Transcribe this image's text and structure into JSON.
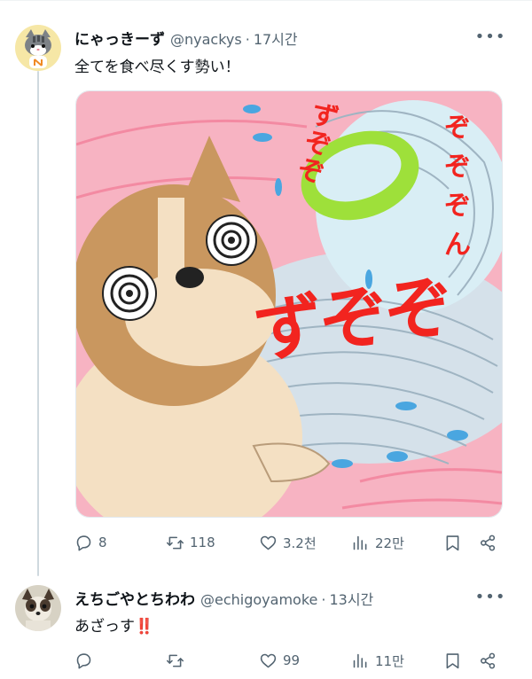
{
  "post": {
    "name": "にゃっきーず",
    "handle": "@nyackys",
    "separator": "·",
    "time": "17시간",
    "text": "全てを食べ尽くす勢い！",
    "media": {
      "caption_letters": [
        "ず",
        "ぞ",
        "ぞ"
      ],
      "swirl_letters": [
        "ず",
        "ぞ",
        "ぞ",
        "ぞ",
        "ぞ",
        "ぞ",
        "ん"
      ],
      "colors": {
        "background": "#f7b3c2",
        "swirl": "#c8e6ef",
        "bowl": "#9ee03a",
        "text": "#f2241f"
      }
    },
    "stats": {
      "replies": "8",
      "reposts": "118",
      "likes": "3.2천",
      "views": "22만"
    }
  },
  "reply": {
    "name": "えちごやとちわわ",
    "handle": "@echigoyamoke",
    "separator": "·",
    "time": "13시간",
    "text": "あざっす",
    "emoji": "‼️",
    "stats": {
      "replies": "",
      "reposts": "",
      "likes": "99",
      "views": "11만"
    }
  },
  "colors": {
    "text": "#0f1419",
    "muted": "#536471",
    "thread_line": "#cfd9de"
  }
}
